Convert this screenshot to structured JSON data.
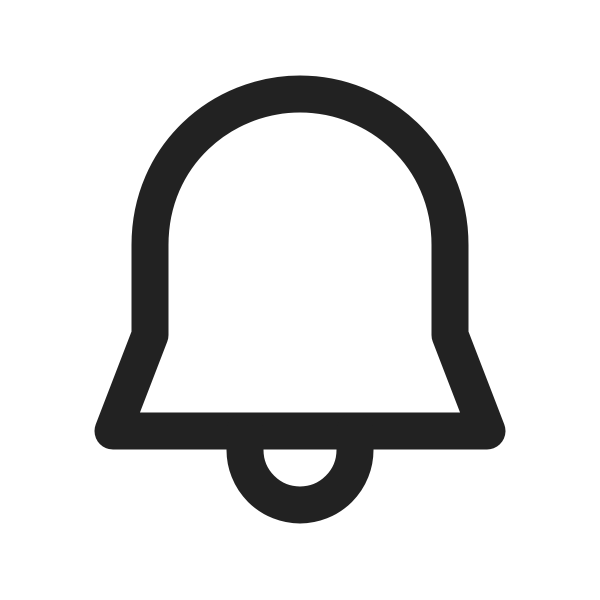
{
  "icon": {
    "name": "bell-icon",
    "style": "outline",
    "stroke_color": "#222222",
    "background_color": "#ffffff"
  }
}
